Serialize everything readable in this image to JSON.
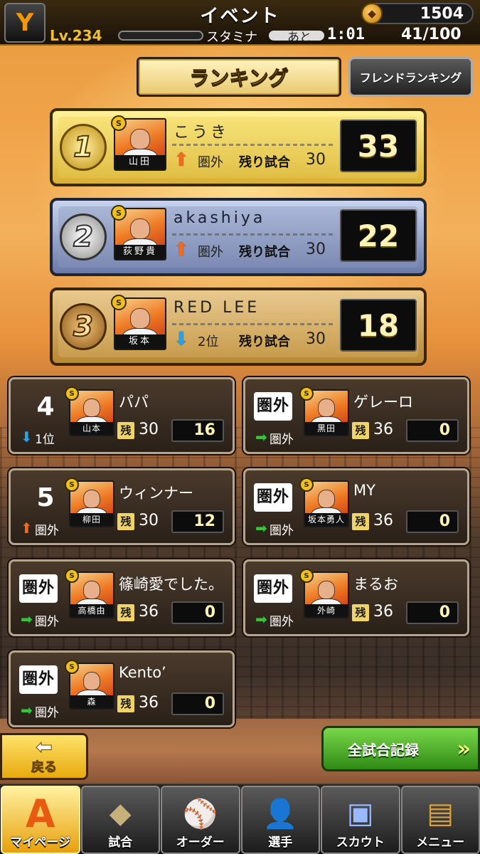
{
  "header": {
    "title": "イベント",
    "coins": "1504",
    "level_label": "Lv.",
    "level": "234",
    "stamina_label": "スタミナ",
    "remaining_label": "あと",
    "timer": "1:01",
    "stamina": "41/100"
  },
  "tabs": {
    "ranking": "ランキング",
    "friend_ranking": "フレンドランキング"
  },
  "remaining_label": "残り試合",
  "remaining_short": "残",
  "top": [
    {
      "rank": "1",
      "name": "こうき",
      "player": "山田",
      "trend": "up",
      "prev": "圏外",
      "games": "30",
      "score": "33"
    },
    {
      "rank": "2",
      "name": "akashiya",
      "player": "荻野貴",
      "trend": "up",
      "prev": "圏外",
      "games": "30",
      "score": "22"
    },
    {
      "rank": "3",
      "name": "RED LEE",
      "player": "坂本",
      "trend": "down",
      "prev": "2位",
      "games": "30",
      "score": "18"
    }
  ],
  "others": [
    {
      "rank": "4",
      "name": "パパ",
      "player": "山本",
      "trend": "down",
      "prev": "1位",
      "games": "30",
      "score": "16"
    },
    {
      "rank": "圏外",
      "name": "ゲレーロ",
      "player": "黒田",
      "trend": "right",
      "prev": "圏外",
      "games": "36",
      "score": "0"
    },
    {
      "rank": "5",
      "name": "ウィンナー",
      "player": "柳田",
      "trend": "up",
      "prev": "圏外",
      "games": "30",
      "score": "12"
    },
    {
      "rank": "圏外",
      "name": "MY",
      "player": "坂本勇人",
      "trend": "right",
      "prev": "圏外",
      "games": "36",
      "score": "0"
    },
    {
      "rank": "圏外",
      "name": "篠崎愛でした。",
      "player": "高橋由",
      "trend": "right",
      "prev": "圏外",
      "games": "36",
      "score": "0"
    },
    {
      "rank": "圏外",
      "name": "まるお",
      "player": "外崎",
      "trend": "right",
      "prev": "圏外",
      "games": "36",
      "score": "0"
    },
    {
      "rank": "圏外",
      "name": "Kento’",
      "player": "森",
      "trend": "right",
      "prev": "圏外",
      "games": "36",
      "score": "0"
    }
  ],
  "buttons": {
    "back": "戻る",
    "all_records": "全試合記録"
  },
  "nav": [
    {
      "label": "マイページ",
      "icon": "A",
      "active": true
    },
    {
      "label": "試合",
      "icon": "◆"
    },
    {
      "label": "オーダー",
      "icon": "⚾"
    },
    {
      "label": "選手",
      "icon": "👤"
    },
    {
      "label": "スカウト",
      "icon": "▣"
    },
    {
      "label": "メニュー",
      "icon": "▤"
    }
  ],
  "colors": {
    "gold": "#e1bf46",
    "silver": "#7c8ab4",
    "bronze": "#c89c4d",
    "accent": "#f39800"
  }
}
